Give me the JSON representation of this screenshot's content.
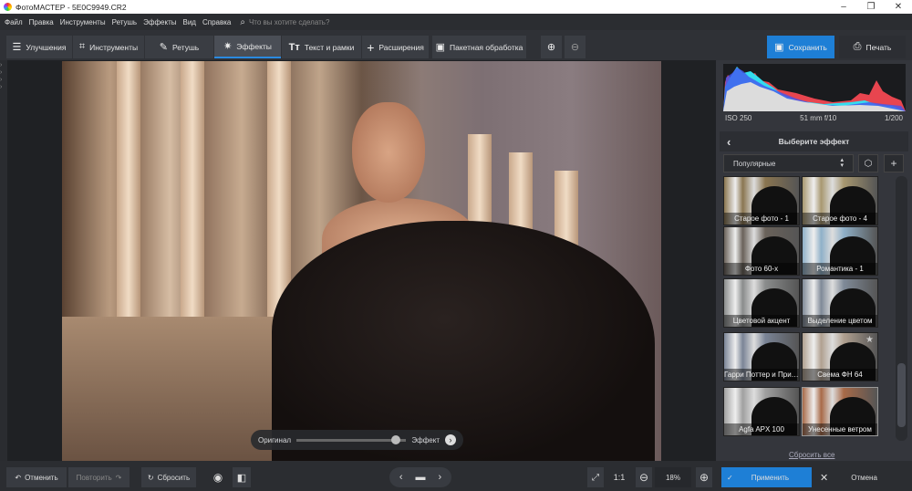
{
  "window": {
    "title": "ФотоМАСТЕР - 5E0C9949.CR2",
    "minimize": "–",
    "maximize": "❐",
    "close": "✕"
  },
  "menu": [
    "Файл",
    "Правка",
    "Инструменты",
    "Ретушь",
    "Эффекты",
    "Вид",
    "Справка"
  ],
  "search": {
    "placeholder": "Что вы хотите сделать?"
  },
  "tabs": [
    {
      "label": "Улучшения",
      "icon": "sliders-icon",
      "glyph": "☰"
    },
    {
      "label": "Инструменты",
      "icon": "crop-icon",
      "glyph": "⌗"
    },
    {
      "label": "Ретушь",
      "icon": "brush-icon",
      "glyph": "✎"
    },
    {
      "label": "Эффекты",
      "icon": "magic-wand-icon",
      "glyph": "✷"
    },
    {
      "label": "Текст и рамки",
      "icon": "text-icon",
      "glyph": "Tт"
    },
    {
      "label": "Расширения",
      "icon": "plus-icon",
      "glyph": "+"
    }
  ],
  "batch": {
    "label": "Пакетная обработка"
  },
  "save": {
    "label": "Сохранить"
  },
  "print": {
    "label": "Печать"
  },
  "compare": {
    "original": "Оригинал",
    "effect": "Эффект",
    "value": 0.95
  },
  "exif": {
    "iso": "ISO 250",
    "lens": "51 mm f/10",
    "shutter": "1/200"
  },
  "effects_panel": {
    "title": "Выберите эффект",
    "category": "Популярные",
    "reset": "Сбросить все",
    "items": [
      {
        "label": "Старое фото - 1",
        "tone": "#8a7550"
      },
      {
        "label": "Старое фото - 4",
        "tone": "#a89870"
      },
      {
        "label": "Фото 60-х",
        "tone": "#6a625a"
      },
      {
        "label": "Романтика - 1",
        "tone": "#8fb0c8"
      },
      {
        "label": "Цветовой акцент",
        "tone": "#8a8c8c"
      },
      {
        "label": "Выделение цветом",
        "tone": "#7f8a98"
      },
      {
        "label": "Гарри Поттер и Принц-полукровка",
        "tone": "#7a8496"
      },
      {
        "label": "Свема ФН 64",
        "tone": "#b0a090"
      },
      {
        "label": "Agfa APX 100",
        "tone": "#a0a0a0"
      },
      {
        "label": "Унесенные ветром",
        "tone": "#a86a48"
      }
    ]
  },
  "bottom": {
    "undo": "Отменить",
    "redo": "Повторить",
    "reset": "Сбросить",
    "zoom_1to1": "1:1",
    "zoom": "18%",
    "apply": "Применить",
    "cancel": "Отмена"
  }
}
